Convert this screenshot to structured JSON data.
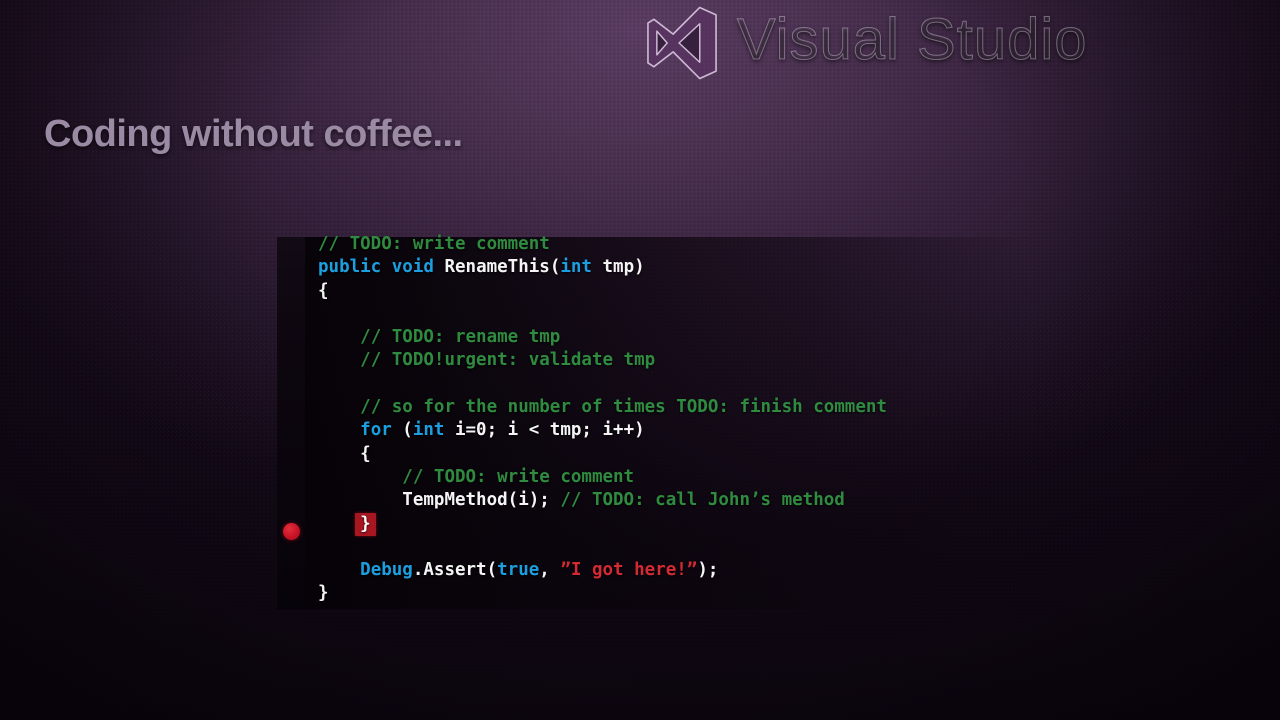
{
  "brand": {
    "logo_icon": "visual-studio-infinity-logo",
    "name": "Visual Studio"
  },
  "slide": {
    "headline": "Coding without coffee..."
  },
  "editor": {
    "gutter": {
      "breakpoint_icon": "breakpoint-dot",
      "breakpoint_color": "#c81325",
      "breakpoint_line": 11
    },
    "colors": {
      "keyword": "#1c9fe0",
      "comment": "#2f8b3f",
      "string": "#d42a33",
      "plain": "#f4f4f4",
      "brace_highlight_bg": "#a81622"
    },
    "lines": [
      {
        "n": 1,
        "indent": 0,
        "tokens": [
          {
            "t": "// TODO: write comment",
            "c": "cmt"
          }
        ]
      },
      {
        "n": 2,
        "indent": 0,
        "tokens": [
          {
            "t": "public",
            "c": "kw"
          },
          {
            "t": " ",
            "c": "plain"
          },
          {
            "t": "void",
            "c": "kw"
          },
          {
            "t": " RenameThis(",
            "c": "plain"
          },
          {
            "t": "int",
            "c": "kw"
          },
          {
            "t": " tmp)",
            "c": "plain"
          }
        ]
      },
      {
        "n": 3,
        "indent": 0,
        "tokens": [
          {
            "t": "{",
            "c": "plain"
          }
        ]
      },
      {
        "n": 4,
        "indent": 0,
        "tokens": []
      },
      {
        "n": 5,
        "indent": 1,
        "tokens": [
          {
            "t": "// TODO: rename tmp",
            "c": "cmt"
          }
        ]
      },
      {
        "n": 6,
        "indent": 1,
        "tokens": [
          {
            "t": "// TODO!urgent: validate tmp",
            "c": "cmt"
          }
        ]
      },
      {
        "n": 7,
        "indent": 0,
        "tokens": []
      },
      {
        "n": 8,
        "indent": 1,
        "tokens": [
          {
            "t": "// so for the number of times TODO: finish comment",
            "c": "cmt"
          }
        ]
      },
      {
        "n": 9,
        "indent": 1,
        "tokens": [
          {
            "t": "for",
            "c": "kw"
          },
          {
            "t": " (",
            "c": "plain"
          },
          {
            "t": "int",
            "c": "kw"
          },
          {
            "t": " i=0; i < tmp; i++)",
            "c": "plain"
          }
        ]
      },
      {
        "n": 10,
        "indent": 1,
        "tokens": [
          {
            "t": "{",
            "c": "plain"
          }
        ]
      },
      {
        "n": 11,
        "indent": 2,
        "tokens": [
          {
            "t": "// TODO: write comment",
            "c": "cmt"
          }
        ]
      },
      {
        "n": 12,
        "indent": 2,
        "tokens": [
          {
            "t": "TempMethod(i); ",
            "c": "plain"
          },
          {
            "t": "// TODO: call John’s method",
            "c": "cmt"
          }
        ]
      },
      {
        "n": 13,
        "indent": 1,
        "tokens": [
          {
            "t": "}",
            "c": "plain brace-hl"
          }
        ]
      },
      {
        "n": 14,
        "indent": 0,
        "tokens": []
      },
      {
        "n": 15,
        "indent": 1,
        "tokens": [
          {
            "t": "Debug",
            "c": "kw"
          },
          {
            "t": ".Assert(",
            "c": "plain"
          },
          {
            "t": "true",
            "c": "kw"
          },
          {
            "t": ", ",
            "c": "plain"
          },
          {
            "t": "”I got here!”",
            "c": "str"
          },
          {
            "t": ");",
            "c": "plain"
          }
        ]
      },
      {
        "n": 16,
        "indent": 0,
        "tokens": [
          {
            "t": "}",
            "c": "plain"
          }
        ]
      }
    ]
  }
}
